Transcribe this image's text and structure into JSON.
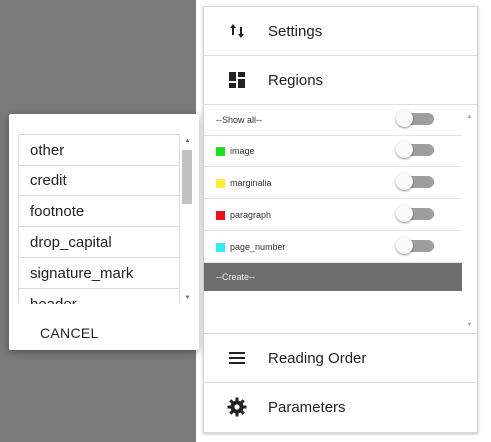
{
  "menu": {
    "settings": "Settings",
    "regions": "Regions",
    "reading_order": "Reading Order",
    "parameters": "Parameters"
  },
  "regions": {
    "show_all": "--Show all--",
    "items": [
      {
        "label": "image",
        "color": "#22dd22"
      },
      {
        "label": "marginalia",
        "color": "#ffee33"
      },
      {
        "label": "paragraph",
        "color": "#ee1111"
      },
      {
        "label": "page_number",
        "color": "#33eeee"
      }
    ],
    "create": "--Create--"
  },
  "dialog": {
    "options": [
      "other",
      "credit",
      "footnote",
      "drop_capital",
      "signature_mark",
      "header"
    ],
    "cancel": "CANCEL"
  },
  "icons": {
    "settings": "sort-arrows-icon",
    "regions": "dashboard-icon",
    "reading_order": "menu-lines-icon",
    "parameters": "gear-icon"
  }
}
